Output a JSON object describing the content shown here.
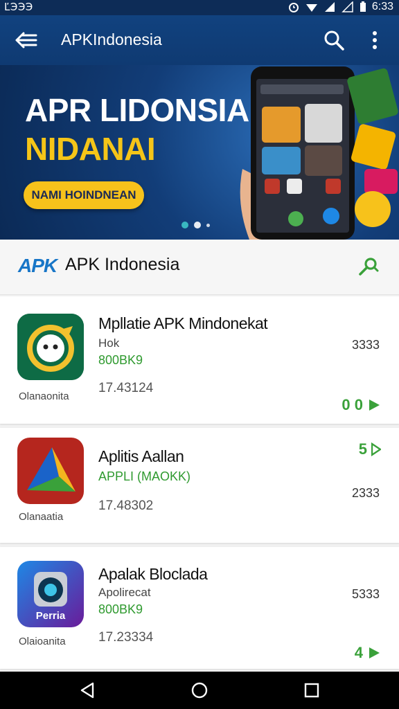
{
  "status": {
    "left": "ĽЭЭЭ",
    "time": "6:33"
  },
  "toolbar": {
    "title": "APKIndonesia"
  },
  "banner": {
    "headline": "APR LIDONSIA",
    "subheadline": "NIDANAI",
    "cta": "NAMI HOINDNEAN"
  },
  "section": {
    "logo": "APK",
    "title": "APK Indonesia"
  },
  "apps": [
    {
      "name": "Mpllatie APK Mindonekat",
      "sub": "Hok",
      "size": "800BK9",
      "version": "17.43124",
      "developer": "Olanaonita",
      "right": "3333",
      "action": "0 0"
    },
    {
      "name": "Aplitis Aallan",
      "sub": "",
      "size": "APPLI (MAOKK)",
      "version": "17.48302",
      "developer": "Olanaatia",
      "right": "2333",
      "action": "5"
    },
    {
      "name": "Apalak Bloclada",
      "sub": "Apolirecat",
      "size": "800BK9",
      "version": "17.23334",
      "developer": "Olaioanita",
      "right": "5333",
      "action": "4"
    }
  ],
  "icons": {
    "app3_label": "Perria"
  },
  "colors": {
    "toolbar": "#11427f",
    "accent_green": "#3aa13a",
    "cta_yellow": "#f7c21b"
  }
}
